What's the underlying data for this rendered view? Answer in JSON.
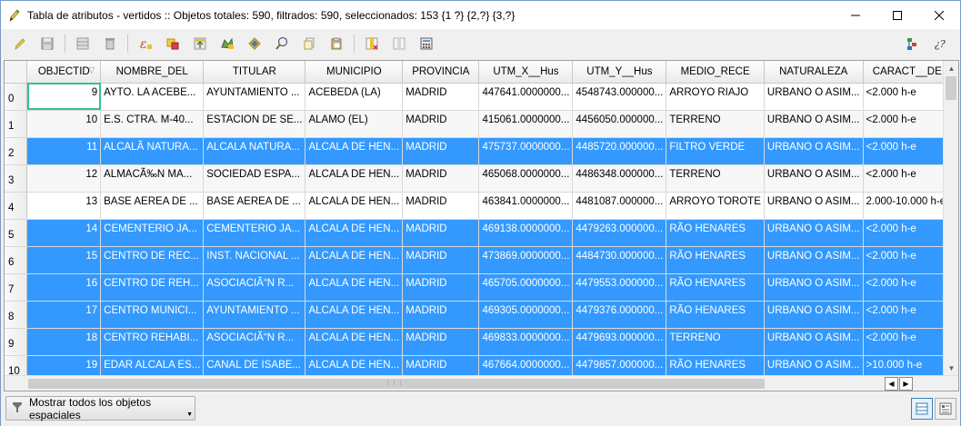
{
  "window": {
    "title": "Tabla de atributos - vertidos :: Objetos totales: 590, filtrados: 590, seleccionados: 153 {1 ?} {2,?} {3,?}",
    "minimize": "—",
    "maximize": "☐",
    "close": "✕"
  },
  "toolbar": {
    "buttons": [
      {
        "name": "toggle-editing-icon"
      },
      {
        "name": "save-edits-icon"
      },
      {
        "name": "add-feature-icon"
      },
      {
        "name": "delete-selected-icon"
      },
      {
        "name": "select-by-expression-icon"
      },
      {
        "name": "invert-selection-icon"
      },
      {
        "name": "move-selection-to-top-icon"
      },
      {
        "name": "pan-to-selection-icon"
      },
      {
        "name": "zoom-to-selection-icon"
      },
      {
        "name": "copy-selected-icon"
      },
      {
        "name": "paste-features-icon"
      },
      {
        "name": "delete-field-icon"
      },
      {
        "name": "new-field-icon"
      },
      {
        "name": "field-calculator-icon"
      }
    ],
    "right": [
      "actions-icon",
      "help-icon"
    ]
  },
  "table": {
    "columns": [
      "OBJECTID",
      "NOMBRE_DEL",
      "TITULAR",
      "MUNICIPIO",
      "PROVINCIA",
      "UTM_X__Hus",
      "UTM_Y__Hus",
      "MEDIO_RECE",
      "NATURALEZA",
      "CARACT__DE"
    ],
    "rows": [
      {
        "n": "0",
        "sel": false,
        "cells": [
          "9",
          "AYTO. LA ACEBE...",
          "AYUNTAMIENTO ...",
          "ACEBEDA (LA)",
          "MADRID",
          "447641.0000000...",
          "4548743.000000...",
          "ARROYO RIAJO",
          "URBANO O ASIM...",
          "<2.000 h-e"
        ]
      },
      {
        "n": "1",
        "sel": false,
        "cells": [
          "10",
          "E.S. CTRA. M-40...",
          "ESTACION DE SE...",
          "ALAMO (EL)",
          "MADRID",
          "415061.0000000...",
          "4456050.000000...",
          "TERRENO",
          "URBANO O ASIM...",
          "<2.000 h-e"
        ]
      },
      {
        "n": "2",
        "sel": true,
        "cells": [
          "11",
          "ALCALÃ NATURA...",
          "ALCALA NATURA...",
          "ALCALA DE HEN...",
          "MADRID",
          "475737.0000000...",
          "4485720.000000...",
          "FILTRO VERDE",
          "URBANO O ASIM...",
          "<2.000 h-e"
        ]
      },
      {
        "n": "3",
        "sel": false,
        "cells": [
          "12",
          "ALMACÃ‰N MA...",
          "SOCIEDAD ESPA...",
          "ALCALA DE HEN...",
          "MADRID",
          "465068.0000000...",
          "4486348.000000...",
          "TERRENO",
          "URBANO O ASIM...",
          "<2.000 h-e"
        ]
      },
      {
        "n": "4",
        "sel": false,
        "cells": [
          "13",
          "BASE AEREA DE ...",
          "BASE AEREA DE ...",
          "ALCALA DE HEN...",
          "MADRID",
          "463841.0000000...",
          "4481087.000000...",
          "ARROYO TOROTE",
          "URBANO O ASIM...",
          "2.000-10.000 h-e"
        ]
      },
      {
        "n": "5",
        "sel": true,
        "cells": [
          "14",
          "CEMENTERIO JA...",
          "CEMENTERIO JA...",
          "ALCALA DE HEN...",
          "MADRID",
          "469138.0000000...",
          "4479263.000000...",
          "RÃO HENARES",
          "URBANO O ASIM...",
          "<2.000 h-e"
        ]
      },
      {
        "n": "6",
        "sel": true,
        "cells": [
          "15",
          "CENTRO DE REC...",
          "INST. NACIONAL ...",
          "ALCALA DE HEN...",
          "MADRID",
          "473869.0000000...",
          "4484730.000000...",
          "RÃO HENARES",
          "URBANO O ASIM...",
          "<2.000 h-e"
        ]
      },
      {
        "n": "7",
        "sel": true,
        "cells": [
          "16",
          "CENTRO DE REH...",
          "ASOCIACIÃ“N R...",
          "ALCALA DE HEN...",
          "MADRID",
          "465705.0000000...",
          "4479553.000000...",
          "RÃO HENARES",
          "URBANO O ASIM...",
          "<2.000 h-e"
        ]
      },
      {
        "n": "8",
        "sel": true,
        "cells": [
          "17",
          "CENTRO MUNICI...",
          "AYUNTAMIENTO ...",
          "ALCALA DE HEN...",
          "MADRID",
          "469305.0000000...",
          "4479376.000000...",
          "RÃO HENARES",
          "URBANO O ASIM...",
          "<2.000 h-e"
        ]
      },
      {
        "n": "9",
        "sel": true,
        "cells": [
          "18",
          "CENTRO REHABI...",
          "ASOCIACIÃ“N R...",
          "ALCALA DE HEN...",
          "MADRID",
          "469833.0000000...",
          "4479693.000000...",
          "TERRENO",
          "URBANO O ASIM...",
          "<2.000 h-e"
        ]
      },
      {
        "n": "10",
        "sel": true,
        "cells": [
          "19",
          "EDAR ALCALA ES...",
          "CANAL DE ISABE...",
          "ALCALA DE HEN...",
          "MADRID",
          "467664.0000000...",
          "4479857.000000...",
          "RÃO HENARES",
          "URBANO O ASIM...",
          ">10.000 h-e"
        ]
      }
    ]
  },
  "bottom": {
    "filter_label": "Mostrar todos los objetos espaciales"
  },
  "colors": {
    "selection": "#3399ff",
    "current_cell_outline": "#34c28a"
  }
}
